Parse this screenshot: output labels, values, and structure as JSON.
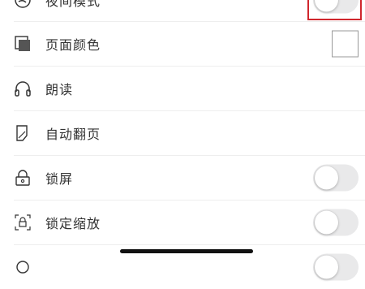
{
  "colors": {
    "accent_highlight": "#d0262d",
    "toggle_off": "#e9e9ea",
    "text": "#333333"
  },
  "settings": {
    "items": [
      {
        "label": "夜间模式",
        "icon": "moon-icon",
        "control": "toggle",
        "state": "off"
      },
      {
        "label": "页面颜色",
        "icon": "page-color-icon",
        "control": "color-swatch",
        "value": "#ffffff"
      },
      {
        "label": "朗读",
        "icon": "headphones-icon",
        "control": "none"
      },
      {
        "label": "自动翻页",
        "icon": "auto-page-icon",
        "control": "none"
      },
      {
        "label": "锁屏",
        "icon": "lock-icon",
        "control": "toggle",
        "state": "off"
      },
      {
        "label": "锁定缩放",
        "icon": "zoom-lock-icon",
        "control": "toggle",
        "state": "off"
      },
      {
        "label": "",
        "icon": "partial-icon",
        "control": "toggle",
        "state": "off"
      }
    ]
  }
}
